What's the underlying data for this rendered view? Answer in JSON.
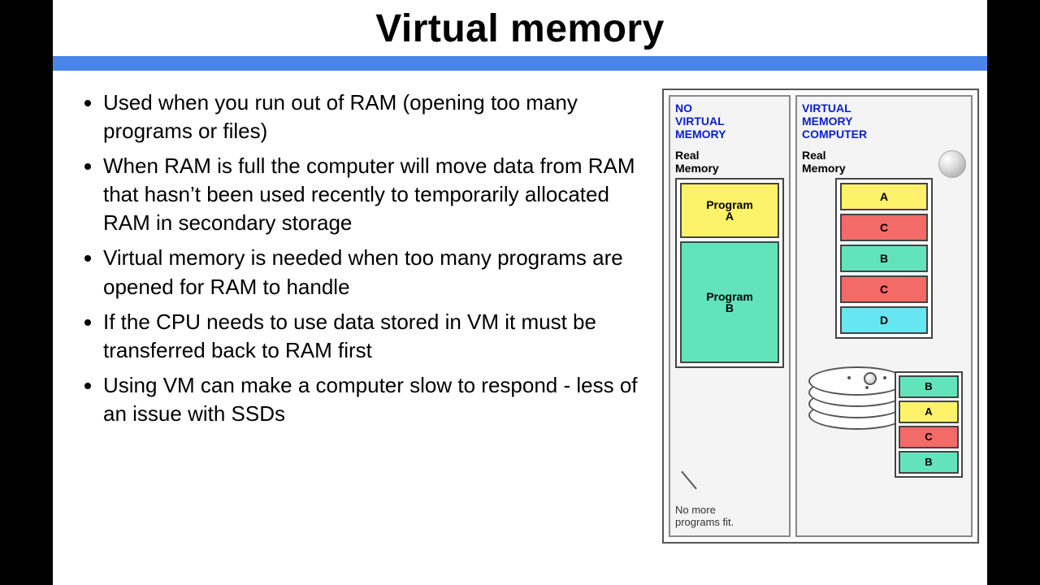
{
  "title": "Virtual memory",
  "bullets": [
    "Used when you run out of RAM (opening too many programs or files)",
    "When RAM is full the computer will move data from RAM that hasn’t been used recently to temporarily allocated RAM in secondary storage",
    "Virtual memory is needed when too many programs are opened for RAM to handle",
    "If the CPU needs to use data stored in VM it must be transferred back to RAM first",
    "Using VM can make a computer slow to respond - less of an issue with SSDs"
  ],
  "illustration": {
    "left": {
      "heading": "NO\nVIRTUAL\nMEMORY",
      "sub": "Real\nMemory",
      "slots": [
        {
          "label": "Program\nA",
          "cls": "slot-A"
        },
        {
          "label": "Program\nB",
          "cls": "slot-B"
        }
      ],
      "caption": "No more\nprograms fit."
    },
    "right": {
      "heading": "VIRTUAL\nMEMORY\nCOMPUTER",
      "sub": "Real\nMemory",
      "slots": [
        {
          "label": "A",
          "cls": "slot-A"
        },
        {
          "label": "C",
          "cls": "slot-C"
        },
        {
          "label": "B",
          "cls": "slot-B"
        },
        {
          "label": "C",
          "cls": "slot-C"
        },
        {
          "label": "D",
          "cls": "slot-D"
        }
      ],
      "swap": [
        {
          "label": "B",
          "cls": "slot-B"
        },
        {
          "label": "A",
          "cls": "slot-A"
        },
        {
          "label": "C",
          "cls": "slot-C"
        },
        {
          "label": "B",
          "cls": "slot-B"
        }
      ]
    }
  }
}
